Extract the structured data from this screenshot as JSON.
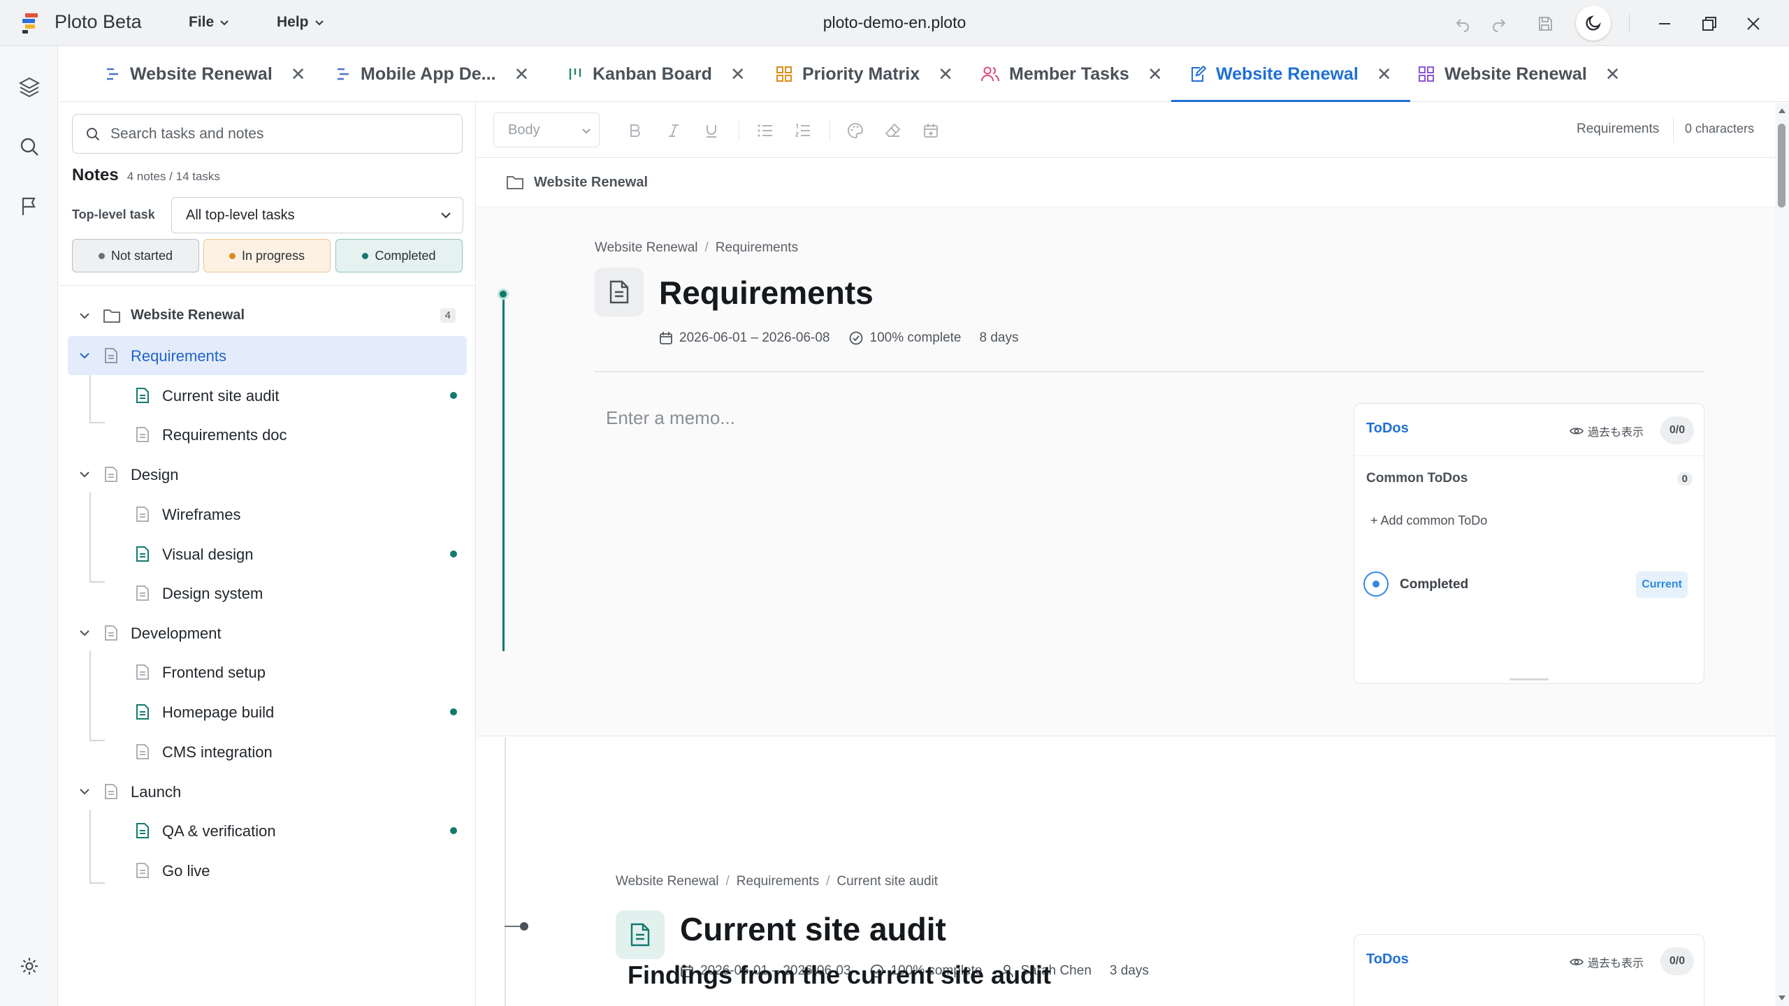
{
  "app": {
    "name": "Ploto Beta",
    "document_title": "ploto-demo-en.ploto",
    "menus": [
      {
        "label": "File"
      },
      {
        "label": "Help"
      }
    ]
  },
  "tabs": [
    {
      "label": "Website Renewal",
      "icon": "gantt-icon",
      "color": "#4d72c9"
    },
    {
      "label": "Mobile App De...",
      "icon": "gantt-icon",
      "color": "#4d72c9"
    },
    {
      "label": "Kanban Board",
      "icon": "kanban-icon",
      "color": "#1f8a5b"
    },
    {
      "label": "Priority Matrix",
      "icon": "matrix-icon",
      "color": "#e08a1b"
    },
    {
      "label": "Member Tasks",
      "icon": "members-icon",
      "color": "#d94b7a"
    },
    {
      "label": "Website Renewal",
      "icon": "note-edit-icon",
      "color": "#1f6fd6",
      "active": true
    },
    {
      "label": "Website Renewal",
      "icon": "dashboard-icon",
      "color": "#8a56d6"
    }
  ],
  "sidebar": {
    "search_placeholder": "Search tasks and notes",
    "title": "Notes",
    "counts": "4 notes / 14 tasks",
    "filter_label": "Top-level task",
    "filter_value": "All top-level tasks",
    "status_buttons": [
      {
        "label": "Not started",
        "color": "#6b7075"
      },
      {
        "label": "In progress",
        "color": "#e08a1b"
      },
      {
        "label": "Completed",
        "color": "#127a6d"
      }
    ],
    "tree": {
      "root": {
        "label": "Website Renewal",
        "badge": "4"
      },
      "groups": [
        {
          "label": "Requirements",
          "selected": true,
          "children": [
            {
              "label": "Current site audit",
              "has_note": true
            },
            {
              "label": "Requirements doc",
              "has_note": false
            }
          ]
        },
        {
          "label": "Design",
          "children": [
            {
              "label": "Wireframes",
              "has_note": false
            },
            {
              "label": "Visual design",
              "has_note": true
            },
            {
              "label": "Design system",
              "has_note": false
            }
          ]
        },
        {
          "label": "Development",
          "children": [
            {
              "label": "Frontend setup",
              "has_note": false
            },
            {
              "label": "Homepage build",
              "has_note": true
            },
            {
              "label": "CMS integration",
              "has_note": false
            }
          ]
        },
        {
          "label": "Launch",
          "children": [
            {
              "label": "QA & verification",
              "has_note": true
            },
            {
              "label": "Go live",
              "has_note": false
            }
          ]
        }
      ]
    }
  },
  "toolbar": {
    "style_value": "Body",
    "section_label": "Requirements",
    "char_count": "0 characters"
  },
  "editor": {
    "breadcrumb_bar": "Website Renewal",
    "node1": {
      "crumbs": [
        "Website Renewal",
        "Requirements"
      ],
      "title": "Requirements",
      "dates": "2026-06-01 – 2026-06-08",
      "complete": "100% complete",
      "duration": "8 days",
      "memo_placeholder": "Enter a memo...",
      "todos": {
        "title": "ToDos",
        "show_past": "過去も表示",
        "count": "0/0",
        "common_title": "Common ToDos",
        "common_count": "0",
        "add_common": "+ Add common ToDo",
        "completed_label": "Completed",
        "current_badge": "Current"
      }
    },
    "node2": {
      "crumbs": [
        "Website Renewal",
        "Requirements",
        "Current site audit"
      ],
      "title": "Current site audit",
      "dates": "2026-06-01 – 2026-06-03",
      "complete": "100% complete",
      "assignee": "Sarah Chen",
      "duration": "3 days",
      "heading": "Findings from the current site audit",
      "todos": {
        "title": "ToDos",
        "show_past": "過去も表示",
        "count": "0/0"
      }
    }
  },
  "colors": {
    "accent": "#1f6fd6",
    "teal": "#127a6d",
    "selected_bg": "#e4ecfb"
  }
}
